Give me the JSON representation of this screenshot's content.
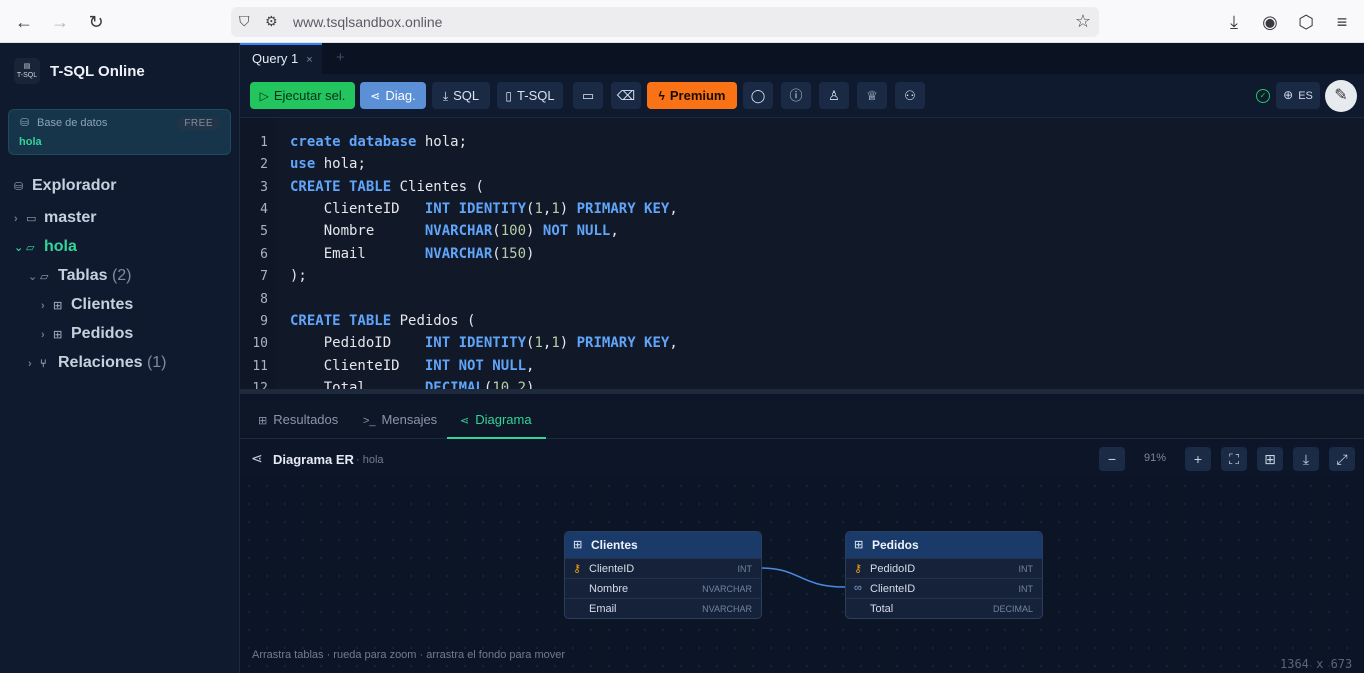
{
  "browser": {
    "url": "www.tsqlsandbox.online"
  },
  "sidebar": {
    "app_name": "T-SQL Online",
    "logo_text": "T-SQL",
    "db_label": "Base de datos",
    "db_badge": "FREE",
    "db_value": "hola",
    "explorer_title": "Explorador",
    "tree": {
      "master": "master",
      "hola": "hola",
      "tablas": "Tablas",
      "tablas_count": "(2)",
      "clientes": "Clientes",
      "pedidos": "Pedidos",
      "relaciones": "Relaciones",
      "relaciones_count": "(1)"
    }
  },
  "tabs": {
    "query": "Query 1",
    "close": "×",
    "add": "+"
  },
  "toolbar": {
    "run": "Ejecutar sel.",
    "diag": "Diag.",
    "sql": "SQL",
    "tsql": "T-SQL",
    "premium": "Premium",
    "lang": "ES"
  },
  "editor": {
    "line_numbers": [
      "1",
      "2",
      "3",
      "4",
      "5",
      "6",
      "7",
      "8",
      "9",
      "10",
      "11",
      "12"
    ]
  },
  "results_tabs": {
    "results": "Resultados",
    "messages": "Mensajes",
    "diagram": "Diagrama"
  },
  "diagram": {
    "title": "Diagrama ER",
    "subtitle": "· hola",
    "zoom": "91%",
    "hint": "Arrastra tablas · rueda para zoom · arrastra el fondo para mover",
    "tables": [
      {
        "name": "Clientes",
        "columns": [
          {
            "name": "ClienteID",
            "type": "INT",
            "key": "pk"
          },
          {
            "name": "Nombre",
            "type": "NVARCHAR",
            "key": ""
          },
          {
            "name": "Email",
            "type": "NVARCHAR",
            "key": ""
          }
        ]
      },
      {
        "name": "Pedidos",
        "columns": [
          {
            "name": "PedidoID",
            "type": "INT",
            "key": "pk"
          },
          {
            "name": "ClienteID",
            "type": "INT",
            "key": "fk"
          },
          {
            "name": "Total",
            "type": "DECIMAL",
            "key": ""
          }
        ]
      }
    ]
  },
  "dimensions_label": "1364 x 673",
  "colors": {
    "accent": "#34d399",
    "run": "#22c55e",
    "premium": "#f97316",
    "diag": "#5b8fd6"
  }
}
